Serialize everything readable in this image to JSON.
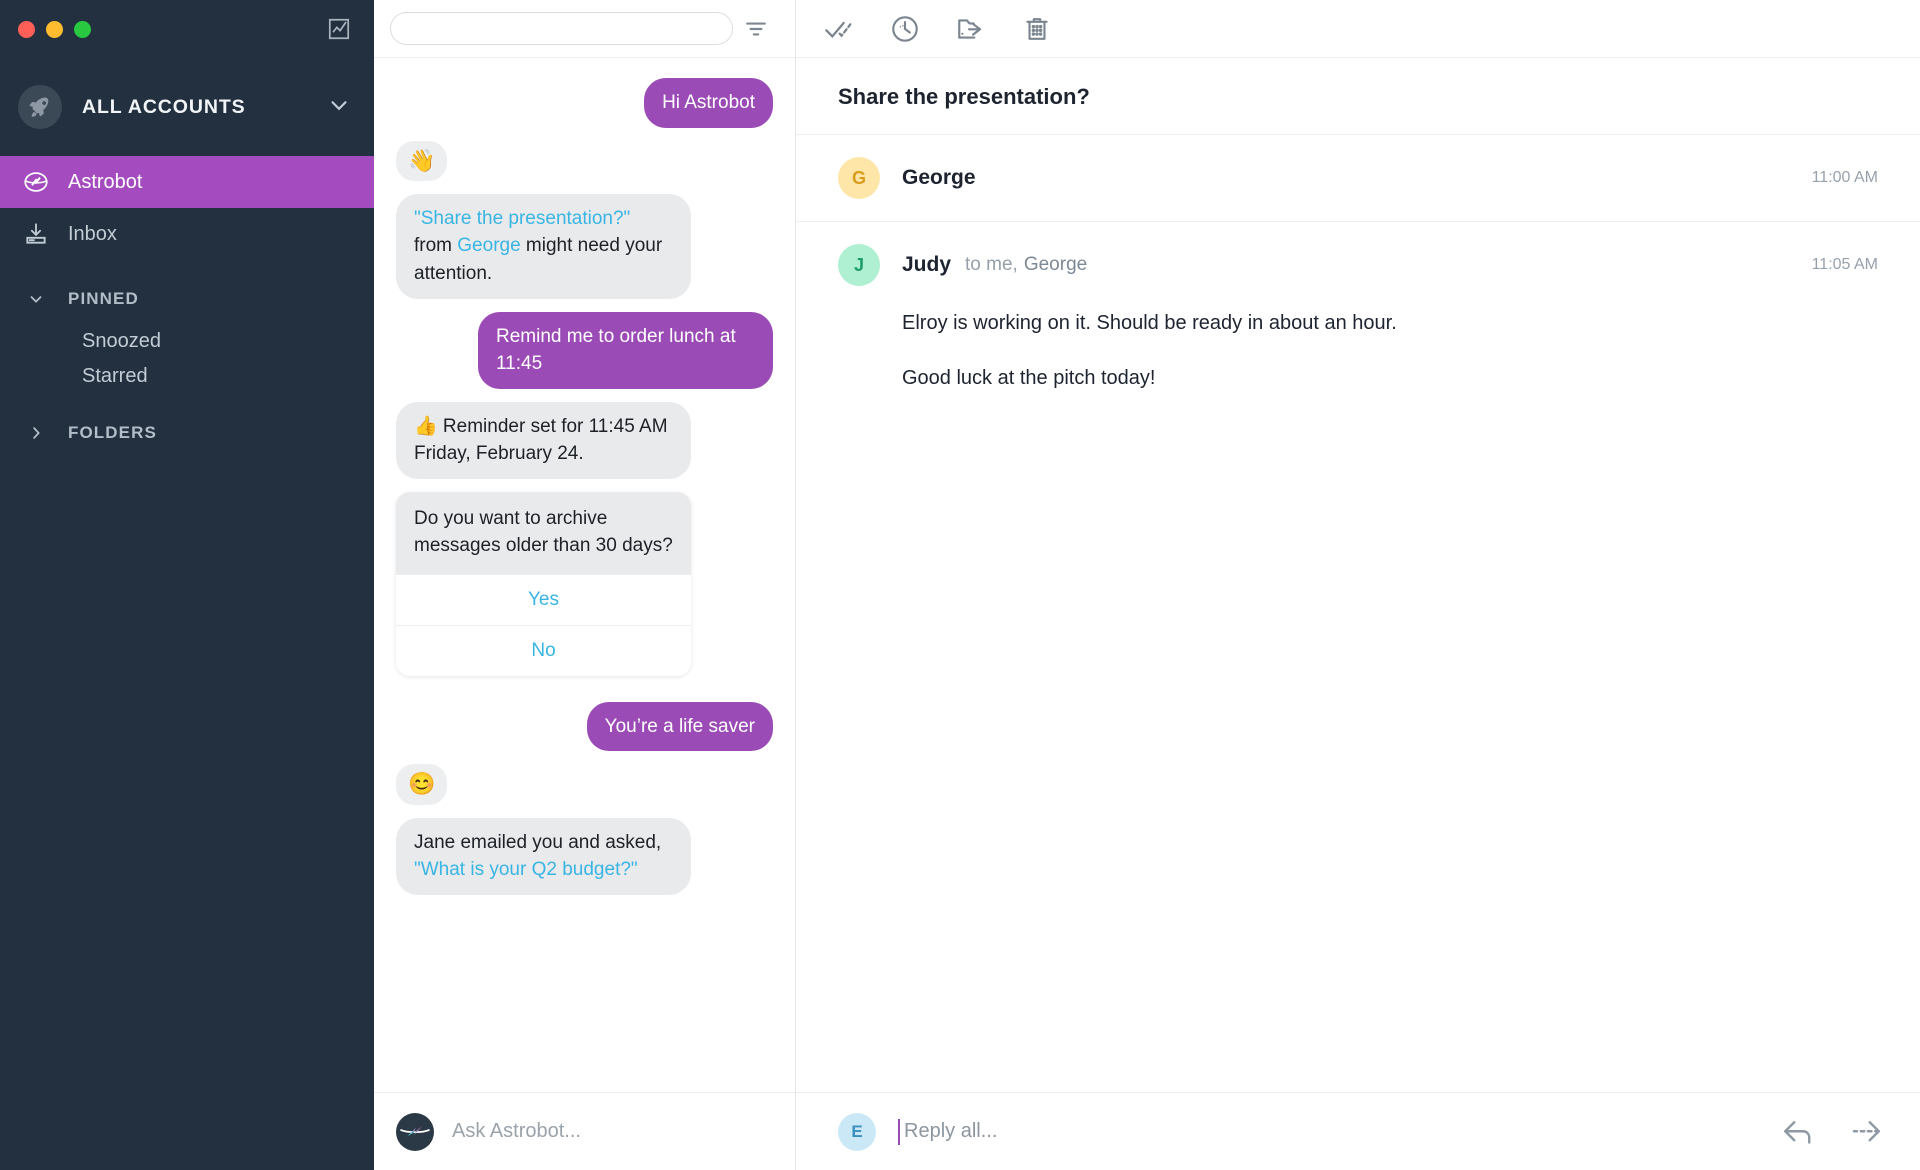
{
  "window": {
    "traffic_lights": [
      "close",
      "minimize",
      "zoom"
    ],
    "compose_icon": "compose-icon"
  },
  "sidebar": {
    "account": {
      "label": "ALL ACCOUNTS",
      "icon": "rocket-icon",
      "chevron": "chevron-down-icon"
    },
    "nav": [
      {
        "label": "Astrobot",
        "icon": "astrobot-icon",
        "active": true
      },
      {
        "label": "Inbox",
        "icon": "inbox-icon",
        "active": false
      }
    ],
    "sections": [
      {
        "title": "PINNED",
        "arrow": "chevron-down-icon",
        "expanded": true,
        "items": [
          {
            "label": "Snoozed"
          },
          {
            "label": "Starred"
          }
        ]
      },
      {
        "title": "FOLDERS",
        "arrow": "chevron-right-icon",
        "expanded": false,
        "items": []
      }
    ]
  },
  "chat": {
    "search": {
      "value": "",
      "placeholder": ""
    },
    "filter_icon": "filter-icon",
    "messages": [
      {
        "type": "bubble",
        "side": "out",
        "text": "Hi Astrobot"
      },
      {
        "type": "emoji",
        "side": "in",
        "text": "👋"
      },
      {
        "type": "rich",
        "side": "in",
        "parts": [
          {
            "text": "\"Share the presentation?\"",
            "link": true
          },
          {
            "text": " from ",
            "link": false
          },
          {
            "text": "George",
            "link": true
          },
          {
            "text": " might need your attention.",
            "link": false
          }
        ]
      },
      {
        "type": "bubble",
        "side": "out",
        "text": "Remind me to order lunch at 11:45"
      },
      {
        "type": "bubble",
        "side": "in",
        "text": "👍 Reminder set for 11:45 AM Friday, February 24."
      },
      {
        "type": "card",
        "question": "Do you want to archive messages older than 30 days?",
        "options": [
          "Yes",
          "No"
        ]
      },
      {
        "type": "bubble",
        "side": "out",
        "text": "You’re a life saver"
      },
      {
        "type": "emoji",
        "side": "in",
        "text": "😊"
      },
      {
        "type": "rich",
        "side": "in",
        "parts": [
          {
            "text": "Jane emailed you and asked, ",
            "link": false
          },
          {
            "text": "\"What is your Q2 budget?\"",
            "link": true
          }
        ]
      }
    ],
    "compose": {
      "avatar_icon": "astrobot-avatar",
      "placeholder": "Ask Astrobot..."
    }
  },
  "mail": {
    "toolbar": [
      {
        "name": "mark-done-button",
        "icon": "double-check-icon"
      },
      {
        "name": "snooze-button",
        "icon": "clock-icon"
      },
      {
        "name": "move-to-folder-button",
        "icon": "folder-move-icon"
      },
      {
        "name": "delete-button",
        "icon": "trash-icon"
      }
    ],
    "subject": "Share the presentation?",
    "messages": [
      {
        "sender": "George",
        "initial": "G",
        "avatar_color": "#fde6a8",
        "initial_color": "#d99b1c",
        "recipients_prefix": "",
        "recipients": "",
        "time": "11:00 AM",
        "paragraphs": []
      },
      {
        "sender": "Judy",
        "initial": "J",
        "avatar_color": "#aef0d1",
        "initial_color": "#1f9e6c",
        "recipients_prefix": "to me,",
        "recipients": "George",
        "time": "11:05 AM",
        "paragraphs": [
          "Elroy is working on it. Should be ready in about an hour.",
          "Good luck at the pitch today!"
        ]
      }
    ],
    "reply": {
      "avatar_initial": "E",
      "placeholder": "Reply all...",
      "actions": [
        {
          "name": "reply-button",
          "icon": "reply-arrow-icon"
        },
        {
          "name": "forward-button",
          "icon": "forward-arrow-icon"
        }
      ]
    }
  },
  "colors": {
    "sidebar_bg": "#22303f",
    "accent_purple": "#9b4bb5",
    "active_purple": "#a44bc0",
    "link_cyan": "#39b5e3",
    "bubble_gray": "#e9eaec"
  }
}
